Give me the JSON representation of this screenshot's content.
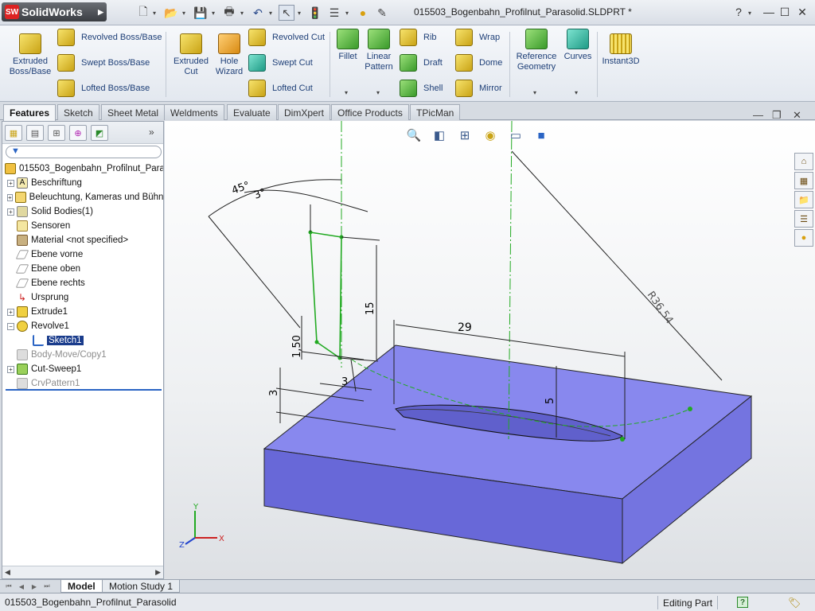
{
  "app": {
    "brand": "SolidWorks",
    "logo_mark": "SW",
    "document_title": "015503_Bogenbahn_Profilnut_Parasolid.SLDPRT *"
  },
  "ribbon": {
    "extruded_boss": "Extruded Boss/Base",
    "revolved_boss": "Revolved Boss/Base",
    "swept_boss": "Swept Boss/Base",
    "lofted_boss": "Lofted Boss/Base",
    "extruded_cut": "Extruded Cut",
    "hole_wizard": "Hole Wizard",
    "revolved_cut": "Revolved Cut",
    "swept_cut": "Swept Cut",
    "lofted_cut": "Lofted Cut",
    "fillet": "Fillet",
    "linear_pattern": "Linear Pattern",
    "rib": "Rib",
    "draft": "Draft",
    "shell": "Shell",
    "wrap": "Wrap",
    "dome": "Dome",
    "mirror": "Mirror",
    "reference_geometry": "Reference Geometry",
    "curves": "Curves",
    "instant3d": "Instant3D"
  },
  "tabs": [
    "Features",
    "Sketch",
    "Sheet Metal",
    "Weldments",
    "Evaluate",
    "DimXpert",
    "Office Products",
    "TPicMan"
  ],
  "tree": {
    "root": "015503_Bogenbahn_Profilnut_Parasolid",
    "items": [
      {
        "label": "Beschriftung",
        "icon": "annotations-icon"
      },
      {
        "label": "Beleuchtung, Kameras und Bühne",
        "icon": "lights-icon"
      },
      {
        "label": "Solid Bodies(1)",
        "icon": "solid-bodies-icon"
      },
      {
        "label": "Sensoren",
        "icon": "sensors-icon"
      },
      {
        "label": "Material <not specified>",
        "icon": "material-icon"
      },
      {
        "label": "Ebene vorne",
        "icon": "plane-icon"
      },
      {
        "label": "Ebene oben",
        "icon": "plane-icon"
      },
      {
        "label": "Ebene rechts",
        "icon": "plane-icon"
      },
      {
        "label": "Ursprung",
        "icon": "origin-icon"
      },
      {
        "label": "Extrude1",
        "icon": "extrude-icon"
      },
      {
        "label": "Revolve1",
        "icon": "revolve-icon"
      },
      {
        "label": "Sketch1",
        "icon": "sketch-icon"
      },
      {
        "label": "Body-Move/Copy1",
        "icon": "move-copy-icon"
      },
      {
        "label": "Cut-Sweep1",
        "icon": "cut-sweep-icon"
      },
      {
        "label": "CrvPattern1",
        "icon": "curve-pattern-icon"
      }
    ]
  },
  "dimensions": {
    "angle_45": "45°",
    "angle_3": "3°",
    "d15": "15",
    "d29": "29",
    "d150": "1,50",
    "d3_small": "3",
    "d3_left": "3",
    "d5": "5",
    "radius": "R36,54"
  },
  "triad": {
    "x": "X",
    "y": "Y",
    "z": "Z"
  },
  "bottom_tabs": [
    "Model",
    "Motion Study 1"
  ],
  "status": {
    "file": "015503_Bogenbahn_Profilnut_Parasolid",
    "mode": "Editing Part",
    "help": "?"
  },
  "colors": {
    "part": "#7878e0",
    "sketch": "#22aa22",
    "selected": "#1a3c8c"
  }
}
